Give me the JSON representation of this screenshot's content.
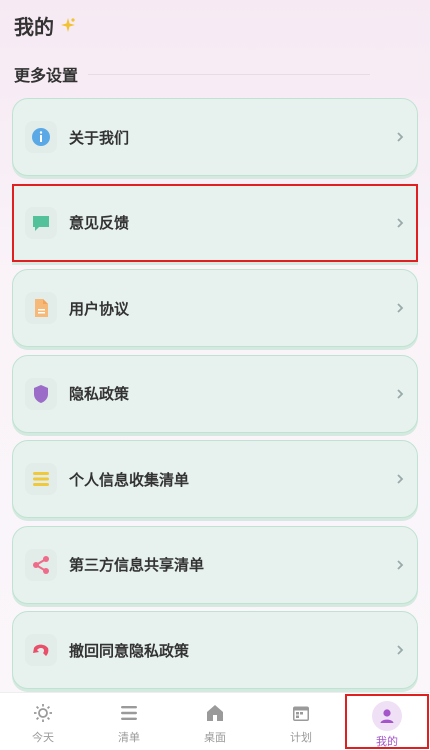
{
  "header": {
    "title": "我的",
    "icon": "sparkle-icon"
  },
  "section": {
    "title": "更多设置"
  },
  "items": [
    {
      "label": "关于我们",
      "icon": "info-icon",
      "color": "#5aa9e6"
    },
    {
      "label": "意见反馈",
      "icon": "chat-icon",
      "color": "#53c29a"
    },
    {
      "label": "用户协议",
      "icon": "document-icon",
      "color": "#f4a35a"
    },
    {
      "label": "隐私政策",
      "icon": "shield-icon",
      "color": "#9b6cc8"
    },
    {
      "label": "个人信息收集清单",
      "icon": "list-icon",
      "color": "#f0c93b"
    },
    {
      "label": "第三方信息共享清单",
      "icon": "share-icon",
      "color": "#ee6b8a"
    },
    {
      "label": "撤回同意隐私政策",
      "icon": "undo-icon",
      "color": "#e8506a"
    }
  ],
  "tabs": [
    {
      "label": "今天",
      "icon": "sun-icon"
    },
    {
      "label": "清单",
      "icon": "list-icon"
    },
    {
      "label": "桌面",
      "icon": "home-icon"
    },
    {
      "label": "计划",
      "icon": "calendar-icon"
    },
    {
      "label": "我的",
      "icon": "user-icon",
      "active": true
    }
  ],
  "colors": {
    "accent": "#a455c9",
    "card_bg": "#e7f2ee",
    "card_border": "#bfe3d2",
    "highlight": "#e02020"
  }
}
